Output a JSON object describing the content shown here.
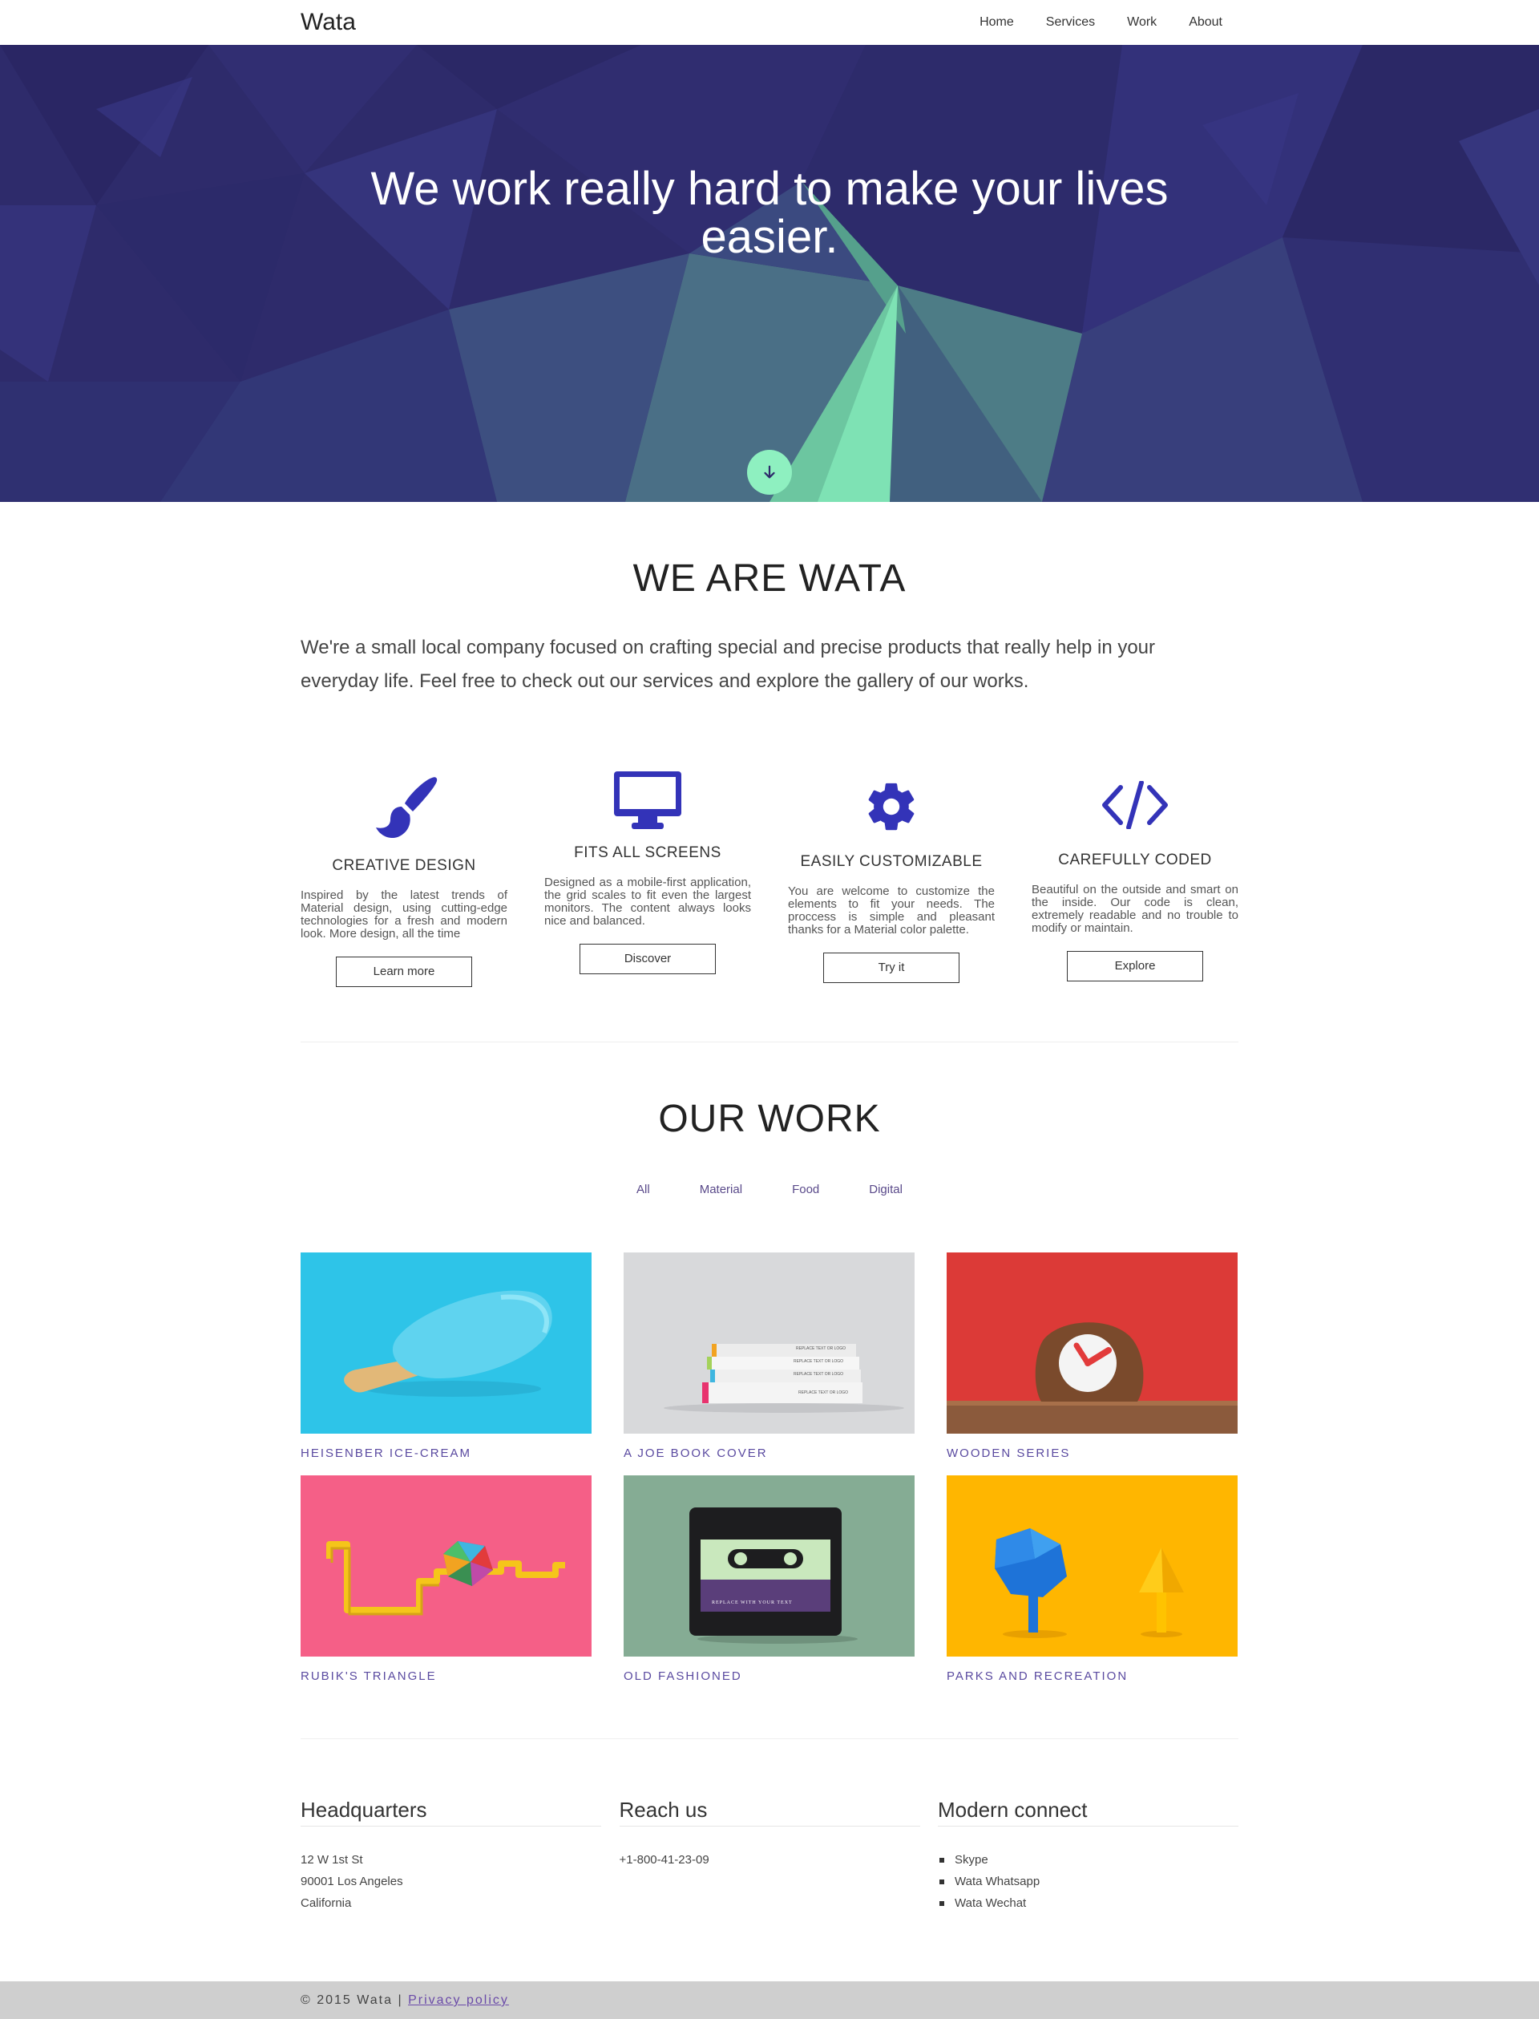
{
  "nav": {
    "brand": "Wata",
    "links": [
      "Home",
      "Services",
      "Work",
      "About"
    ]
  },
  "hero": {
    "headline": "We work really hard to make your lives easier.",
    "scroll_icon": "arrow-down-icon"
  },
  "about": {
    "title": "WE ARE WATA",
    "intro": "We're a small local company focused on crafting special and precise products that really help in your everyday life. Feel free to check out our services and explore the gallery of our works.",
    "features": [
      {
        "icon": "paintbrush-icon",
        "title": "CREATIVE DESIGN",
        "text": "Inspired by the latest trends of Material design, using cutting-edge technologies for a fresh and modern look. More design, all the time",
        "button": "Learn more"
      },
      {
        "icon": "monitor-icon",
        "title": "FITS ALL SCREENS",
        "text": "Designed as a mobile-first application, the grid scales to fit even the largest monitors. The content always looks nice and balanced.",
        "button": "Discover"
      },
      {
        "icon": "gear-icon",
        "title": "EASILY CUSTOMIZABLE",
        "text": "You are welcome to customize the elements to fit your needs. The proccess is simple and pleasant thanks for a Material color palette.",
        "button": "Try it"
      },
      {
        "icon": "code-icon",
        "title": "CAREFULLY CODED",
        "text": "Beautiful on the outside and smart on the inside. Our code is clean, extremely readable and no trouble to modify or maintain.",
        "button": "Explore"
      }
    ],
    "accent_color": "#3333b8"
  },
  "work": {
    "title": "OUR WORK",
    "filters": [
      "All",
      "Material",
      "Food",
      "Digital"
    ],
    "items": [
      {
        "caption": "HEISENBER ICE-CREAM",
        "bg": "#2ec4e8"
      },
      {
        "caption": "A JOE BOOK COVER",
        "bg": "#d8d9db"
      },
      {
        "caption": "WOODEN SERIES",
        "bg": "#dc3a37"
      },
      {
        "caption": "RUBIK'S TRIANGLE",
        "bg": "#f55f87"
      },
      {
        "caption": "OLD FASHIONED",
        "bg": "#85ac94"
      },
      {
        "caption": "PARKS AND RECREATION",
        "bg": "#ffb600"
      }
    ],
    "book_labels": [
      "REPLACE TEXT OR LOGO",
      "REPLACE TEXT OR LOGO",
      "REPLACE TEXT OR LOGO",
      "REPLACE TEXT OR LOGO"
    ],
    "cassette_label": "REPLACE WITH YOUR TEXT"
  },
  "contact": {
    "hq_title": "Headquarters",
    "hq_lines": [
      "12 W 1st St",
      "90001 Los Angeles",
      "California"
    ],
    "reach_title": "Reach us",
    "phone": "+1-800-41-23-09",
    "modern_title": "Modern connect",
    "modern_items": [
      "Skype",
      "Wata Whatsapp",
      "Wata Wechat"
    ]
  },
  "footer": {
    "copyright": "© 2015 Wata |",
    "privacy": "Privacy policy"
  },
  "colors": {
    "hero_bg": "#2d2a6a",
    "hero_accent": "#8ef0c0",
    "caption": "#5a4aa0",
    "footer_bg": "#cfcfcf"
  }
}
